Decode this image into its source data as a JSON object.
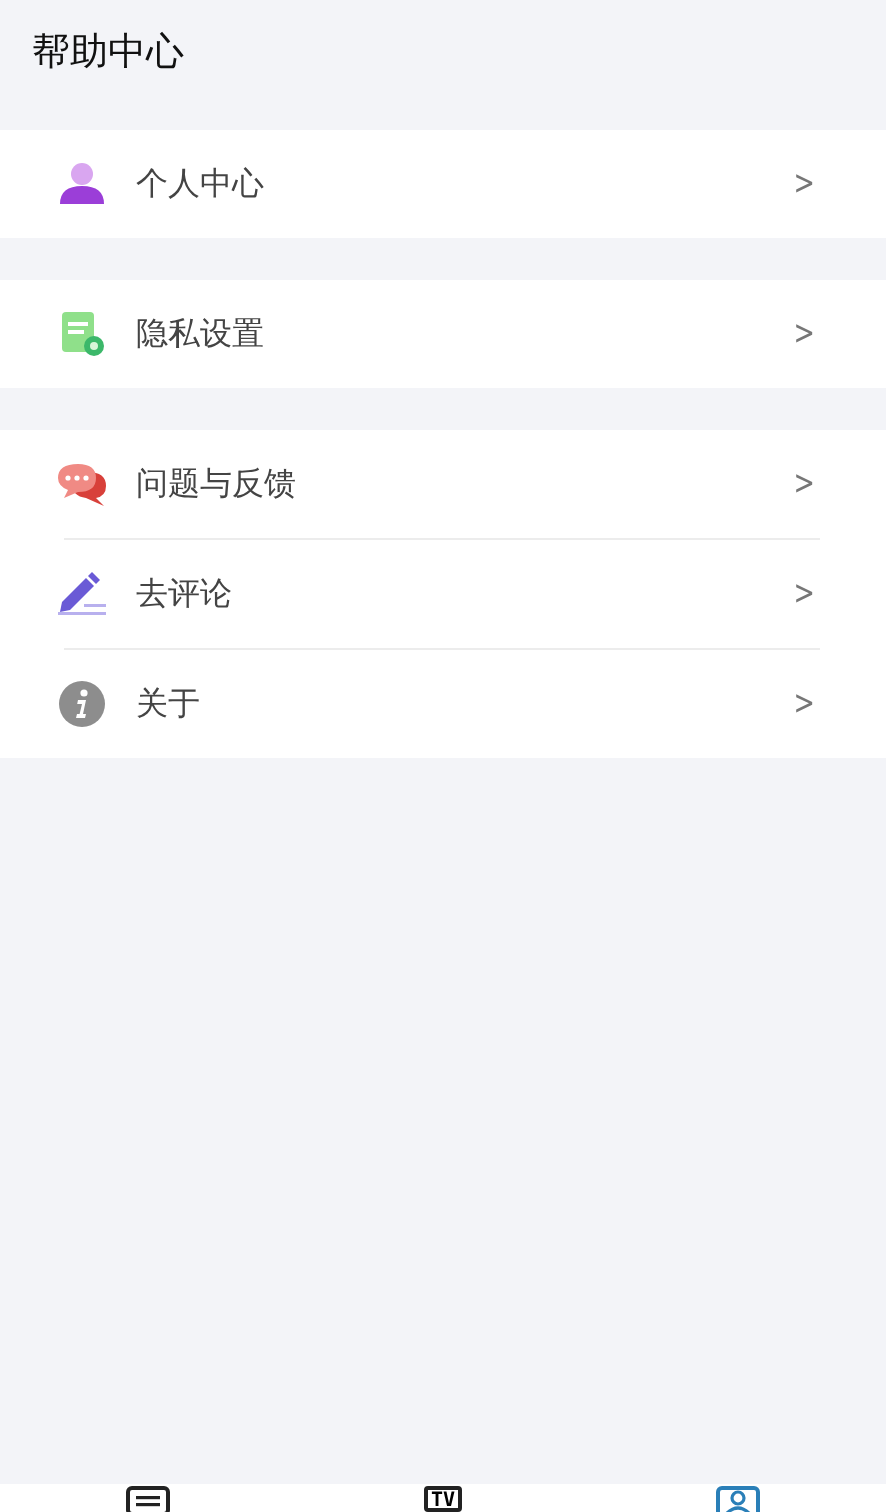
{
  "header": {
    "title": "帮助中心"
  },
  "groups": [
    {
      "items": [
        {
          "kind": "person",
          "label": "个人中心",
          "chevron": ">"
        }
      ]
    },
    {
      "items": [
        {
          "kind": "document",
          "label": "隐私设置",
          "chevron": ">"
        }
      ]
    },
    {
      "items": [
        {
          "kind": "chat",
          "label": "问题与反馈",
          "chevron": ">"
        },
        {
          "kind": "pen",
          "label": "去评论",
          "chevron": ">"
        },
        {
          "kind": "info",
          "label": "关于",
          "chevron": ">"
        }
      ]
    }
  ],
  "tab_bar": {
    "tabs": [
      {
        "kind": "list",
        "selected": false
      },
      {
        "kind": "tv",
        "text": "TV",
        "selected": false
      },
      {
        "kind": "profile",
        "selected": true
      }
    ]
  }
}
